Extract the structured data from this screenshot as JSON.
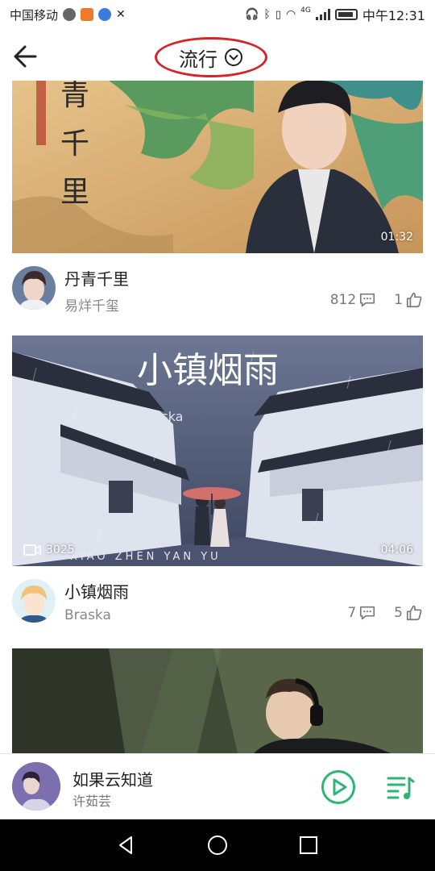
{
  "status_bar": {
    "carrier": "中国移动",
    "network": "4G",
    "time": "中午12:31"
  },
  "header": {
    "title": "流行"
  },
  "feed": [
    {
      "title": "丹青千里",
      "artist": "易烊千玺",
      "duration": "01:32",
      "comments": "812",
      "likes": "1",
      "thumb_text": [
        "青",
        "千",
        "里"
      ]
    },
    {
      "title": "小镇烟雨",
      "artist": "Braska",
      "duration": "04:06",
      "views": "3025",
      "comments": "7",
      "likes": "5",
      "thumb_title": "小镇烟雨",
      "thumb_sub": "Braska",
      "thumb_caption": "XIAO  ZHEN  YAN  YU"
    }
  ],
  "player": {
    "title": "如果云知道",
    "artist": "许茹芸"
  },
  "colors": {
    "accent": "#2bb673",
    "circle": "#d4242a"
  }
}
